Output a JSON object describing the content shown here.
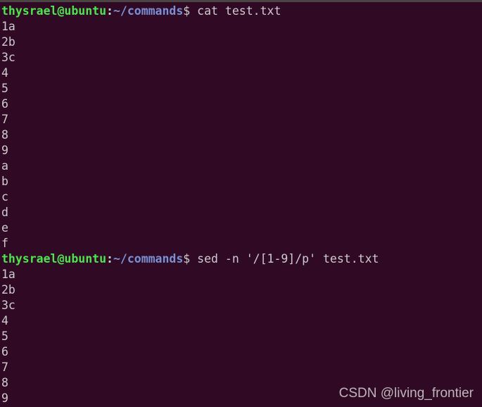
{
  "terminal": {
    "background_color": "#300a24",
    "foreground_color": "#d0cfcc",
    "top_bar_color": "#4a4442",
    "prompt_user_color": "#4ee44e",
    "prompt_path_color": "#7b8fd4"
  },
  "prompt": {
    "user_host": "thysrael@ubuntu",
    "separator": ":",
    "path": "~/commands",
    "sigil": "$"
  },
  "blocks": [
    {
      "command": " cat test.txt",
      "output": [
        "1a",
        "2b",
        "3c",
        "4",
        "5",
        "6",
        "7",
        "8",
        "9",
        "a",
        "b",
        "c",
        "d",
        "e",
        "f"
      ]
    },
    {
      "command": " sed -n '/[1-9]/p' test.txt",
      "output": [
        "1a",
        "2b",
        "3c",
        "4",
        "5",
        "6",
        "7",
        "8",
        "9"
      ]
    }
  ],
  "watermark": {
    "text": "CSDN @living_frontier"
  }
}
